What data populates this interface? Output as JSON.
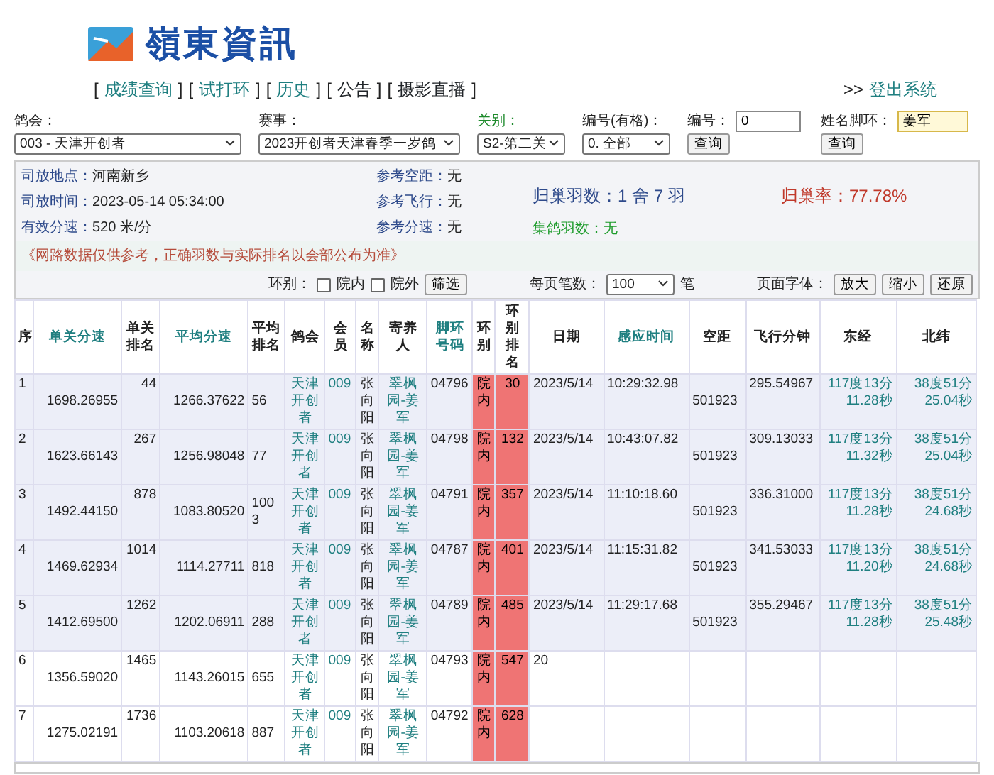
{
  "logo": {
    "text": "嶺東資訊"
  },
  "nav": [
    {
      "open": "[",
      "label": "成绩查询",
      "close": "]",
      "linked": true
    },
    {
      "open": "[",
      "label": "试打环",
      "close": "]",
      "linked": true
    },
    {
      "open": "[",
      "label": "历史",
      "close": "]",
      "linked": true
    },
    {
      "open": "[",
      "label": "公告",
      "close": "]",
      "linked": false
    },
    {
      "open": "[",
      "label": "摄影直播",
      "close": "]",
      "linked": false
    }
  ],
  "logout": {
    "prefix": ">>",
    "label": "登出系统"
  },
  "filters": [
    {
      "kind": "select",
      "label": "鸽会：",
      "value": "003 - 天津开创者",
      "highlight": false
    },
    {
      "kind": "select",
      "label": "赛事：",
      "value": "2023开创者天津春季一岁鸽",
      "highlight": false
    },
    {
      "kind": "select",
      "label": "关别：",
      "value": "S2-第二关",
      "highlight": true
    },
    {
      "kind": "select",
      "label": "编号(有格)：",
      "value": "0. 全部",
      "highlight": false
    },
    {
      "kind": "input",
      "label": "编号：",
      "value": "0",
      "button": "查询",
      "focused": false
    },
    {
      "kind": "input",
      "label": "姓名脚环：",
      "value": "姜军",
      "button": "查询",
      "focused": true
    }
  ],
  "info": {
    "left": [
      {
        "label": "司放地点：",
        "value": "河南新乡"
      },
      {
        "label": "司放时间：",
        "value": "2023-05-14 05:34:00"
      },
      {
        "label": "有效分速：",
        "value": "520 米/分"
      }
    ],
    "middle": [
      {
        "label": "参考空距：",
        "value": "无"
      },
      {
        "label": "参考飞行：",
        "value": "无"
      },
      {
        "label": "参考分速：",
        "value": "无"
      }
    ],
    "returned": "归巢羽数：1 舍 7 羽",
    "rate": "归巢率：77.78%",
    "collected": "集鸽羽数：无",
    "notice": "《网路数据仅供参考，正确羽数与实际排名以会部公布为准》"
  },
  "controls": {
    "ring_label": "环别：",
    "options": [
      {
        "label": "院内",
        "checked": false
      },
      {
        "label": "院外",
        "checked": false
      }
    ],
    "filter_button": "筛选",
    "per_page_label": "每页笔数：",
    "per_page": "100",
    "per_page_unit": "笔",
    "font_label": "页面字体：",
    "font_buttons": [
      "放大",
      "缩小",
      "还原"
    ]
  },
  "columns": [
    {
      "label": "序",
      "sortable": false
    },
    {
      "label": "单关分速",
      "sortable": true
    },
    {
      "label": "单关排名",
      "sortable": false
    },
    {
      "label": "平均分速",
      "sortable": true
    },
    {
      "label": "平均排名",
      "sortable": false
    },
    {
      "label": "鸽会",
      "sortable": false
    },
    {
      "label": "会员",
      "sortable": false
    },
    {
      "label": "名称",
      "sortable": false
    },
    {
      "label": "寄养人",
      "sortable": false
    },
    {
      "label": "脚环号码",
      "sortable": true
    },
    {
      "label": "环别",
      "sortable": false
    },
    {
      "label": "环别排名",
      "sortable": false
    },
    {
      "label": "日期",
      "sortable": false
    },
    {
      "label": "感应时间",
      "sortable": true
    },
    {
      "label": "空距",
      "sortable": false
    },
    {
      "label": "飞行分钟",
      "sortable": false
    },
    {
      "label": "东经",
      "sortable": false
    },
    {
      "label": "北纬",
      "sortable": false
    }
  ],
  "rows": [
    {
      "highlighted": true,
      "no": "1",
      "speed": "1698.26955",
      "speed_rank": "44",
      "avg_speed": "1266.37622",
      "avg_rank": "56",
      "club": "天津开创者",
      "member": "009",
      "name": "张向阳",
      "owner": "翠枫园-姜军",
      "ring": "04796",
      "ring_type": "院内",
      "ring_rank": "30",
      "date": "2023/5/14",
      "time": "10:29:32.98",
      "distance": "501923",
      "minutes": "295.54967",
      "lon": "117度13分 11.28秒",
      "lat": "38度51分 25.04秒"
    },
    {
      "highlighted": true,
      "no": "2",
      "speed": "1623.66143",
      "speed_rank": "267",
      "avg_speed": "1256.98048",
      "avg_rank": "77",
      "club": "天津开创者",
      "member": "009",
      "name": "张向阳",
      "owner": "翠枫园-姜军",
      "ring": "04798",
      "ring_type": "院内",
      "ring_rank": "132",
      "date": "2023/5/14",
      "time": "10:43:07.82",
      "distance": "501923",
      "minutes": "309.13033",
      "lon": "117度13分 11.32秒",
      "lat": "38度51分 25.04秒"
    },
    {
      "highlighted": true,
      "no": "3",
      "speed": "1492.44150",
      "speed_rank": "878",
      "avg_speed": "1083.80520",
      "avg_rank": "1003",
      "club": "天津开创者",
      "member": "009",
      "name": "张向阳",
      "owner": "翠枫园-姜军",
      "ring": "04791",
      "ring_type": "院内",
      "ring_rank": "357",
      "date": "2023/5/14",
      "time": "11:10:18.60",
      "distance": "501923",
      "minutes": "336.31000",
      "lon": "117度13分 11.28秒",
      "lat": "38度51分 24.68秒"
    },
    {
      "highlighted": true,
      "no": "4",
      "speed": "1469.62934",
      "speed_rank": "1014",
      "avg_speed": "1114.27711",
      "avg_rank": "818",
      "club": "天津开创者",
      "member": "009",
      "name": "张向阳",
      "owner": "翠枫园-姜军",
      "ring": "04787",
      "ring_type": "院内",
      "ring_rank": "401",
      "date": "2023/5/14",
      "time": "11:15:31.82",
      "distance": "501923",
      "minutes": "341.53033",
      "lon": "117度13分 11.20秒",
      "lat": "38度51分 24.68秒"
    },
    {
      "highlighted": true,
      "no": "5",
      "speed": "1412.69500",
      "speed_rank": "1262",
      "avg_speed": "1202.06911",
      "avg_rank": "288",
      "club": "天津开创者",
      "member": "009",
      "name": "张向阳",
      "owner": "翠枫园-姜军",
      "ring": "04789",
      "ring_type": "院内",
      "ring_rank": "485",
      "date": "2023/5/14",
      "time": "11:29:17.68",
      "distance": "501923",
      "minutes": "355.29467",
      "lon": "117度13分 11.28秒",
      "lat": "38度51分 25.48秒"
    },
    {
      "highlighted": false,
      "no": "6",
      "speed": "1356.59020",
      "speed_rank": "1465",
      "avg_speed": "1143.26015",
      "avg_rank": "655",
      "club": "天津开创者",
      "member": "009",
      "name": "张向阳",
      "owner": "翠枫园-姜军",
      "ring": "04793",
      "ring_type": "院内",
      "ring_rank": "547",
      "date": "20"
    },
    {
      "highlighted": false,
      "no": "7",
      "speed": "1275.02191",
      "speed_rank": "1736",
      "avg_speed": "1103.20618",
      "avg_rank": "887",
      "club": "天津开创者",
      "member": "009",
      "name": "张向阳",
      "owner": "翠枫园-姜军",
      "ring": "04792",
      "ring_type": "院内",
      "ring_rank": "628"
    }
  ]
}
